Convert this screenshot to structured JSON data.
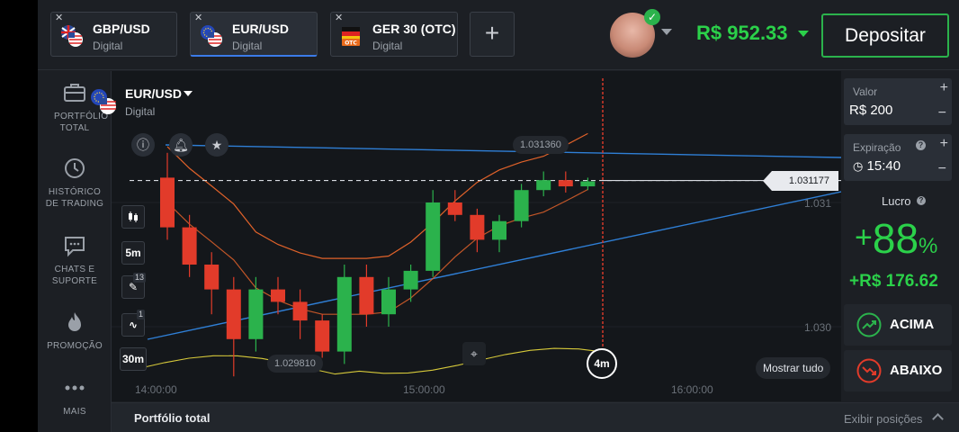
{
  "tabs": [
    {
      "pair": "GBP/USD",
      "kind": "Digital",
      "flag": "gb-us-flag"
    },
    {
      "pair": "EUR/USD",
      "kind": "Digital",
      "flag": "eu-us-flag",
      "active": true
    },
    {
      "pair": "GER 30 (OTC)",
      "kind": "Digital",
      "flag": "de-otc-flag"
    }
  ],
  "account": {
    "balance": "R$ 952.33",
    "deposit_label": "Depositar"
  },
  "sidebar": [
    {
      "label": "PORTFÓLIO TOTAL",
      "icon": "briefcase-icon"
    },
    {
      "label": "HISTÓRICO DE TRADING",
      "icon": "history-icon"
    },
    {
      "label": "CHATS E SUPORTE",
      "icon": "chat-icon"
    },
    {
      "label": "PROMOÇÃO",
      "icon": "flame-icon"
    },
    {
      "label": "MAIS",
      "icon": "more-icon"
    }
  ],
  "chart": {
    "asset": "EUR/USD",
    "asset_kind": "Digital",
    "timeframe": "5m",
    "interval": "30m",
    "indicator_count": "1",
    "drawing_count": "13",
    "current_price": "1.031177",
    "high_label": "1.031360",
    "low_label": "1.029810",
    "y_ticks": [
      "1.031",
      "1.030"
    ],
    "x_ticks": [
      "14:00:00",
      "15:00:00",
      "16:00:00"
    ],
    "timer": "4m",
    "show_all": "Mostrar tudo",
    "colors": {
      "up": "#2bb24c",
      "down": "#e23b2a",
      "expiry": "#e23b2a",
      "trend": "#2f7fd6",
      "boll": "#e0622a",
      "ind": "#d6c93a"
    }
  },
  "chart_data": {
    "type": "candlestick",
    "x_ticks": [
      "14:00:00",
      "15:00:00",
      "16:00:00"
    ],
    "y_ticks": [
      1.031,
      1.03
    ],
    "candles": [
      {
        "o": 1.0312,
        "h": 1.0314,
        "l": 1.0307,
        "c": 1.0308
      },
      {
        "o": 1.0308,
        "h": 1.0309,
        "l": 1.0304,
        "c": 1.0305
      },
      {
        "o": 1.0305,
        "h": 1.0306,
        "l": 1.0301,
        "c": 1.0303
      },
      {
        "o": 1.0303,
        "h": 1.0304,
        "l": 1.0296,
        "c": 1.0299
      },
      {
        "o": 1.0299,
        "h": 1.0304,
        "l": 1.0298,
        "c": 1.0303
      },
      {
        "o": 1.0303,
        "h": 1.0304,
        "l": 1.0301,
        "c": 1.0302
      },
      {
        "o": 1.0302,
        "h": 1.0303,
        "l": 1.0299,
        "c": 1.03005
      },
      {
        "o": 1.03005,
        "h": 1.0301,
        "l": 1.02975,
        "c": 1.0298
      },
      {
        "o": 1.0298,
        "h": 1.0305,
        "l": 1.0297,
        "c": 1.0304
      },
      {
        "o": 1.0304,
        "h": 1.0305,
        "l": 1.03,
        "c": 1.0301
      },
      {
        "o": 1.0301,
        "h": 1.0304,
        "l": 1.03,
        "c": 1.0303
      },
      {
        "o": 1.0303,
        "h": 1.0305,
        "l": 1.0302,
        "c": 1.03045
      },
      {
        "o": 1.03045,
        "h": 1.0311,
        "l": 1.0304,
        "c": 1.031
      },
      {
        "o": 1.031,
        "h": 1.0311,
        "l": 1.03085,
        "c": 1.0309
      },
      {
        "o": 1.0309,
        "h": 1.03095,
        "l": 1.0306,
        "c": 1.0307
      },
      {
        "o": 1.0307,
        "h": 1.0309,
        "l": 1.0306,
        "c": 1.03085
      },
      {
        "o": 1.03085,
        "h": 1.03115,
        "l": 1.0308,
        "c": 1.0311
      },
      {
        "o": 1.0311,
        "h": 1.03125,
        "l": 1.03105,
        "c": 1.03118
      },
      {
        "o": 1.03118,
        "h": 1.03125,
        "l": 1.03108,
        "c": 1.03113
      },
      {
        "o": 1.03113,
        "h": 1.0312,
        "l": 1.0311,
        "c": 1.03117
      }
    ]
  },
  "trade": {
    "amount_label": "Valor",
    "amount": "R$ 200",
    "expiry_label": "Expiração",
    "expiry": "15:40",
    "profit_label": "Lucro",
    "profit_sign": "+",
    "profit_pct": "88",
    "profit_pct_unit": "%",
    "profit_amount": "+R$ 176.62",
    "up_label": "ACIMA",
    "down_label": "ABAIXO",
    "colors": {
      "up": "#2bb24c",
      "down": "#e23b2a"
    }
  },
  "bottom": {
    "title": "Portfólio total",
    "action": "Exibir posições"
  }
}
